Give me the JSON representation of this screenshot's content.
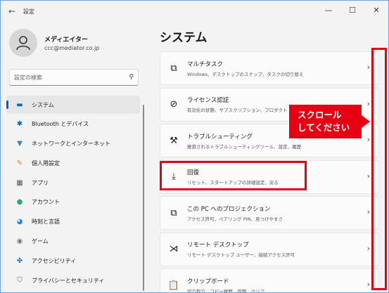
{
  "window": {
    "title": "設定",
    "back_icon": "←",
    "minimize": "—",
    "maximize": "☐",
    "close": "✕"
  },
  "profile": {
    "name": "メディエイター",
    "email": "ccc@mediator.co.jp"
  },
  "search": {
    "placeholder": "設定の検索"
  },
  "sidebar": {
    "items": [
      {
        "label": "システム",
        "icon": "monitor-icon",
        "glyph": "▬",
        "color": "#0067c0",
        "active": true
      },
      {
        "label": "Bluetooth とデバイス",
        "icon": "bluetooth-icon",
        "glyph": "✱",
        "color": "#0067c0"
      },
      {
        "label": "ネットワークとインターネット",
        "icon": "wifi-icon",
        "glyph": "▼",
        "color": "#2b88d8"
      },
      {
        "label": "個人用設定",
        "icon": "brush-icon",
        "glyph": "✎",
        "color": "#e07a2c"
      },
      {
        "label": "アプリ",
        "icon": "apps-icon",
        "glyph": "▦",
        "color": "#555555"
      },
      {
        "label": "アカウント",
        "icon": "account-icon",
        "glyph": "●",
        "color": "#2aa876"
      },
      {
        "label": "時刻と言語",
        "icon": "clock-globe-icon",
        "glyph": "◕",
        "color": "#1a8fd8"
      },
      {
        "label": "ゲーム",
        "icon": "gamepad-icon",
        "glyph": "◉",
        "color": "#777777"
      },
      {
        "label": "アクセシビリティ",
        "icon": "accessibility-icon",
        "glyph": "✤",
        "color": "#1a73c8"
      },
      {
        "label": "プライバシーとセキュリティ",
        "icon": "shield-icon",
        "glyph": "⛉",
        "color": "#666666"
      }
    ]
  },
  "main": {
    "title": "システム",
    "cards": [
      {
        "title": "マルチタスク",
        "desc": "Windows、デスクトップのスナップ、タスクの切り替え",
        "icon": "multitask-icon",
        "glyph": "⧉"
      },
      {
        "title": "ライセンス認証",
        "desc": "有効化の状態、サブスクリプション、プロダクト キー",
        "icon": "check-circle-icon",
        "glyph": "⊘"
      },
      {
        "title": "トラブルシューティング",
        "desc": "推奨されるトラブルシューティングツール、設定、履歴",
        "icon": "wrench-icon",
        "glyph": "⚒"
      },
      {
        "title": "回復",
        "desc": "リセット、スタートアップの詳細設定、戻る",
        "icon": "recovery-icon",
        "glyph": "⤓"
      },
      {
        "title": "この PC へのプロジェクション",
        "desc": "アクセス許可、ペアリング PIN、見つけやすさ",
        "icon": "projection-icon",
        "glyph": "⧉"
      },
      {
        "title": "リモート デスクトップ",
        "desc": "リモート デスクトップ ユーザー、接続アクセス許可",
        "icon": "remote-desktop-icon",
        "glyph": "⋊"
      },
      {
        "title": "クリップボード",
        "desc": "切り取り、コピー履歴、同期、クリア",
        "icon": "clipboard-icon",
        "glyph": "📋"
      }
    ],
    "chevron": "›"
  },
  "annotation": {
    "callout_line1": "スクロール",
    "callout_line2": "してください",
    "accent": "#e60012"
  }
}
